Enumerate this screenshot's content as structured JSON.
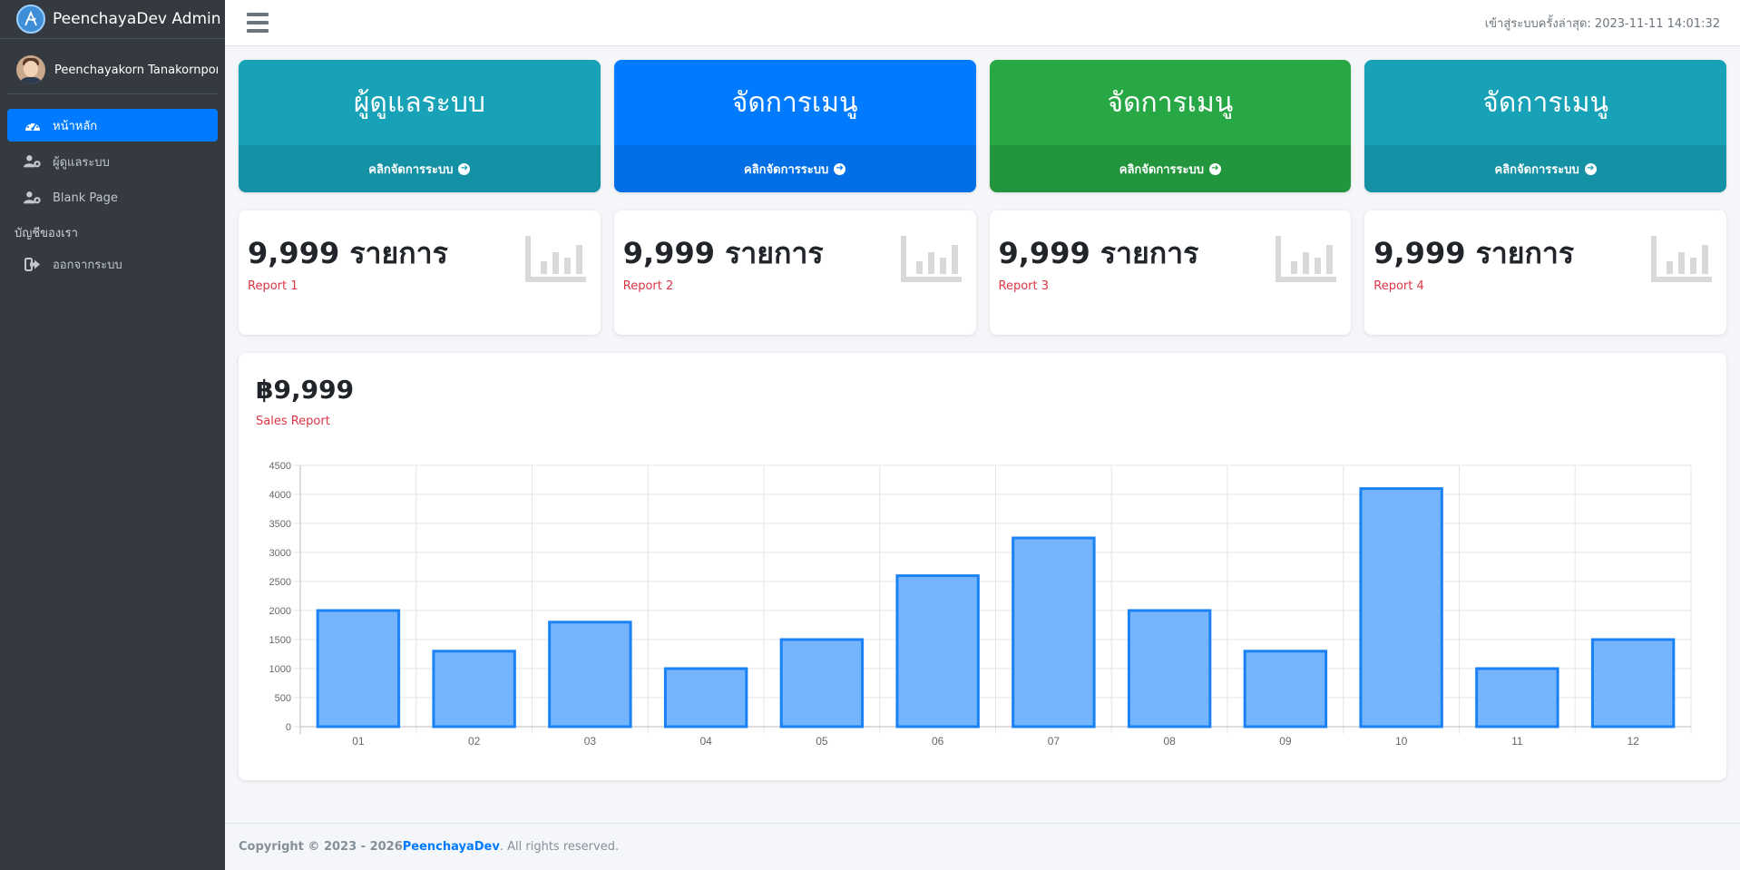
{
  "sidebar": {
    "brand": "PeenchayaDev Admin",
    "user_name": "Peenchayakorn Tanakornporn",
    "items": [
      {
        "label": "หน้าหลัก",
        "icon": "gauge-icon",
        "active": true
      },
      {
        "label": "ผู้ดูแลระบบ",
        "icon": "users-cog-icon",
        "active": false
      },
      {
        "label": "Blank Page",
        "icon": "users-cog-icon",
        "active": false
      }
    ],
    "section_header": "บัญชีของเรา",
    "logout": {
      "label": "ออกจากระบบ",
      "icon": "sign-out-icon"
    }
  },
  "topbar": {
    "last_login": "เข้าสู่ระบบครั้งล่าสุด: 2023-11-11 14:01:32"
  },
  "menu_cards": [
    {
      "title": "ผู้ดูแลระบบ",
      "footer": "คลิกจัดการระบบ",
      "color": "#17a2b8"
    },
    {
      "title": "จัดการเมนู",
      "footer": "คลิกจัดการระบบ",
      "color": "#007bff"
    },
    {
      "title": "จัดการเมนู",
      "footer": "คลิกจัดการระบบ",
      "color": "#28a745"
    },
    {
      "title": "จัดการเมนู",
      "footer": "คลิกจัดการระบบ",
      "color": "#17a2b8"
    }
  ],
  "stat_cards": [
    {
      "value": "9,999 รายการ",
      "label": "Report 1",
      "icon": "chart-bar-icon"
    },
    {
      "value": "9,999 รายการ",
      "label": "Report 2",
      "icon": "chart-bar-icon"
    },
    {
      "value": "9,999 รายการ",
      "label": "Report 3",
      "icon": "chart-bar-icon"
    },
    {
      "value": "9,999 รายการ",
      "label": "Report 4",
      "icon": "chart-bar-icon"
    }
  ],
  "sales": {
    "value": "฿9,999",
    "label": "Sales Report"
  },
  "chart_data": {
    "type": "bar",
    "categories": [
      "01",
      "02",
      "03",
      "04",
      "05",
      "06",
      "07",
      "08",
      "09",
      "10",
      "11",
      "12"
    ],
    "values": [
      2000,
      1300,
      1800,
      1000,
      1500,
      2600,
      3250,
      2000,
      1300,
      4100,
      1000,
      1500
    ],
    "ylim": [
      0,
      4500
    ],
    "yticks": [
      0,
      500,
      1000,
      1500,
      2000,
      2500,
      3000,
      3500,
      4000,
      4500
    ],
    "grid": true,
    "bar_fill": "#75b5fd",
    "bar_stroke": "#1a82f5"
  },
  "footer": {
    "prefix": "Copyright © 2023 - 2026 ",
    "brand": "PeenchayaDev",
    "suffix": ". All rights reserved."
  }
}
